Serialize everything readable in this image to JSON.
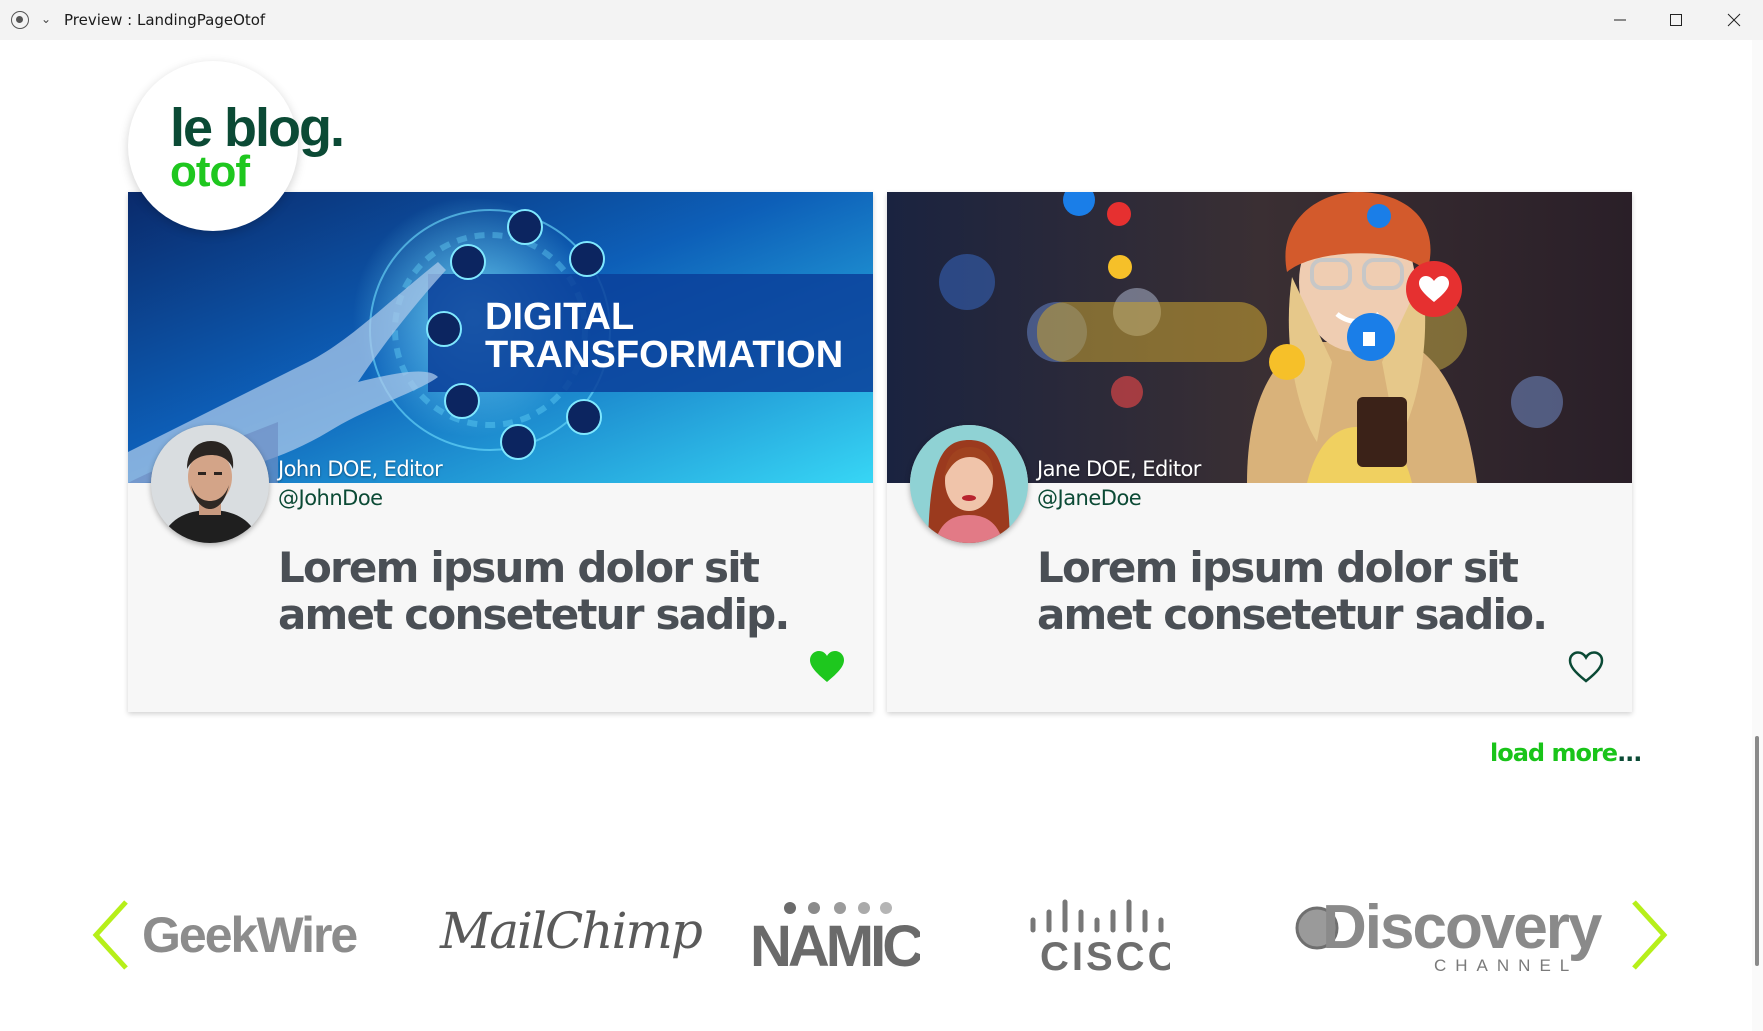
{
  "window": {
    "title": "Preview : LandingPageOtof"
  },
  "logo": {
    "line1": "le blog.",
    "line2": "otof"
  },
  "hero_images": {
    "card1_banner_line1": "DIGITAL",
    "card1_banner_line2": "TRANSFORMATION"
  },
  "posts": [
    {
      "author": "John DOE, Editor",
      "handle": "@JohnDoe",
      "headline": "Lorem ipsum dolor sit amet consetetur sadip.",
      "liked": true
    },
    {
      "author": "Jane DOE, Editor",
      "handle": "@JaneDoe",
      "headline": "Lorem ipsum dolor sit amet consetetur sadio.",
      "liked": false
    }
  ],
  "load_more": {
    "label": "load more",
    "dots": "..."
  },
  "brands": {
    "geekwire": "GeekWire",
    "mailchimp": "MailChimp",
    "namic": "NAMIC",
    "cisco": "CISCO",
    "discovery": "Discovery",
    "discovery_sub": "CHANNEL"
  },
  "colors": {
    "accent_green": "#1ec71e",
    "dark_green": "#0b4a35",
    "arrow_lime": "#b6ef1a",
    "heading_gray": "#4a4f55"
  },
  "icons": {
    "liked": "heart-filled-icon",
    "unliked": "heart-outline-icon",
    "prev": "chevron-left-icon",
    "next": "chevron-right-icon"
  }
}
